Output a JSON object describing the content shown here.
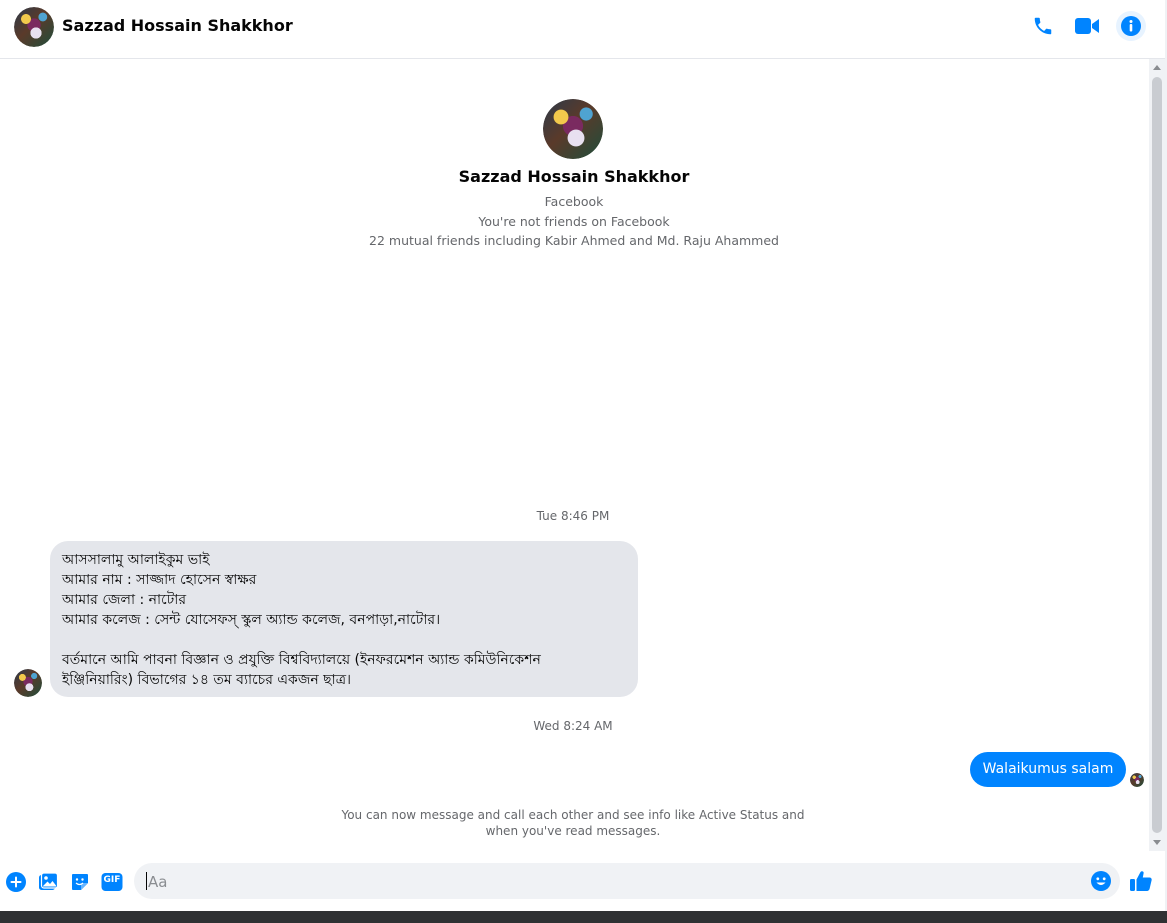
{
  "header": {
    "title": "Sazzad Hossain Shakkhor"
  },
  "profile": {
    "name": "Sazzad Hossain Shakkhor",
    "source": "Facebook",
    "friend_status": "You're not friends on Facebook",
    "mutual": "22 mutual friends including Kabir Ahmed and Md. Raju Ahammed"
  },
  "conversation": {
    "timestamp_1": "Tue 8:46 PM",
    "incoming_lines": [
      "আসসালামু আলাইকুম ভাই",
      "আমার নাম : সাজ্জাদ হোসেন স্বাক্ষর",
      "আমার জেলা : নাটোর",
      "আমার কলেজ : সেন্ট যোসেফস্ স্কুল অ্যান্ড কলেজ, বনপাড়া,নাটোর।",
      "",
      "বর্তমানে আমি পাবনা বিজ্ঞান ও প্রযুক্তি বিশ্ববিদ্যালয়ে (ইনফরমেশন অ্যান্ড কমিউনিকেশন",
      "ইঞ্জিনিয়ারিং) বিভাগের ১৪ তম ব্যাচের একজন ছাত্র।"
    ],
    "timestamp_2": "Wed 8:24 AM",
    "outgoing": "Walaikumus salam",
    "notice_line1": "You can now message and call each other and see info like Active Status and",
    "notice_line2": "when you've read messages."
  },
  "composer": {
    "placeholder": "Aa",
    "gif_label": "GIF"
  },
  "colors": {
    "accent": "#0084ff",
    "bubble_in": "#e4e6eb",
    "muted_text": "#65676b"
  },
  "icons": [
    "phone-icon",
    "video-camera-icon",
    "info-icon",
    "plus-circle-icon",
    "photo-icon",
    "sticker-icon",
    "gif-icon",
    "emoji-icon",
    "thumbs-up-icon"
  ]
}
